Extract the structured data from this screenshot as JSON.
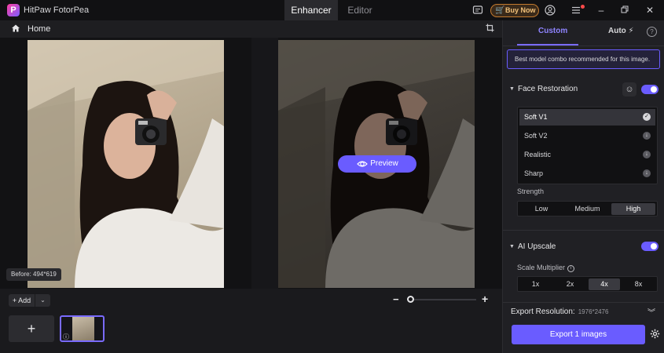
{
  "titlebar": {
    "app_name": "HitPaw FotorPea",
    "logo_letter": "P",
    "tabs": [
      {
        "label": "Enhancer",
        "active": true
      },
      {
        "label": "Editor",
        "active": false
      }
    ],
    "buy_label": "Buy Now",
    "icons": [
      "feedback-icon",
      "cart-icon",
      "account-icon",
      "menu-icon",
      "minimize-icon",
      "restore-icon",
      "close-icon"
    ]
  },
  "homebar": {
    "home_label": "Home"
  },
  "canvas": {
    "preview_label": "Preview",
    "before_label": "Before: 494*619"
  },
  "bottom": {
    "add_label": "+ Add",
    "add_tile_glyph": "+",
    "thumb_info": "ⓘ",
    "zoom": {
      "level": 0.0
    }
  },
  "panel": {
    "tabs": [
      {
        "label": "Custom",
        "active": true
      },
      {
        "label": "Auto ⚡",
        "active": false
      }
    ],
    "hint": "Best model combo recommended for this image.",
    "face_restoration": {
      "title": "Face Restoration",
      "enabled": true,
      "models": [
        {
          "label": "Soft V1",
          "selected": true
        },
        {
          "label": "Soft V2",
          "selected": false
        },
        {
          "label": "Realistic",
          "selected": false
        },
        {
          "label": "Sharp",
          "selected": false
        }
      ],
      "strength_label": "Strength",
      "strength_options": [
        "Low",
        "Medium",
        "High"
      ],
      "strength_selected": "High"
    },
    "ai_upscale": {
      "title": "AI Upscale",
      "enabled": true,
      "scale_label": "Scale Multiplier",
      "scale_options": [
        "1x",
        "2x",
        "4x",
        "8x"
      ],
      "scale_selected": "4x"
    },
    "export_resolution_label": "Export Resolution:",
    "export_resolution_value": "1976*2476",
    "export_button": "Export 1 images"
  },
  "colors": {
    "accent": "#6a5cff",
    "background": "#1a1a1d",
    "panel": "#202024",
    "buy_border": "#c27a2f"
  }
}
